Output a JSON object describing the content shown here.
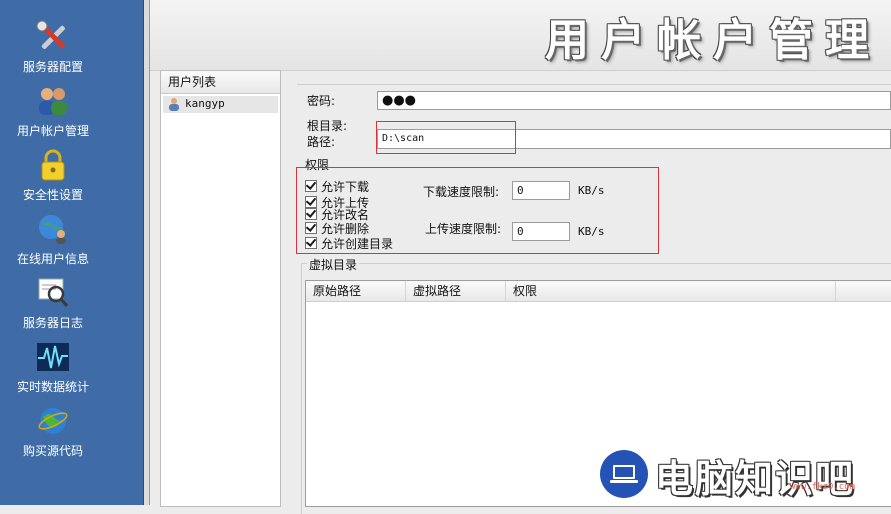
{
  "sidebar": {
    "items": [
      {
        "label": "服务器配置",
        "icon": "tools-icon"
      },
      {
        "label": "用户帐户管理",
        "icon": "users-icon"
      },
      {
        "label": "安全性设置",
        "icon": "lock-icon"
      },
      {
        "label": "在线用户信息",
        "icon": "globe-user-icon"
      },
      {
        "label": "服务器日志",
        "icon": "log-search-icon"
      },
      {
        "label": "实时数据统计",
        "icon": "pulse-icon"
      },
      {
        "label": "购买源代码",
        "icon": "globe-icon"
      }
    ]
  },
  "header": {
    "title": "用户帐户管理"
  },
  "user_list": {
    "header": "用户列表",
    "users": [
      {
        "name": "kangyp",
        "icon": "user-icon"
      }
    ]
  },
  "form": {
    "password_label": "密码:",
    "password_value": "●●●",
    "root_label": "根目录:",
    "path_label": "路径:",
    "path_value": "D:\\scan",
    "permissions_label": "权限",
    "permissions": [
      {
        "label": "允许下载",
        "checked": true
      },
      {
        "label": "允许上传",
        "checked": true
      },
      {
        "label": "允许改名",
        "checked": true
      },
      {
        "label": "允许删除",
        "checked": true
      },
      {
        "label": "允许创建目录",
        "checked": true
      }
    ],
    "download_limit_label": "下载速度限制:",
    "download_limit_value": "0",
    "upload_limit_label": "上传速度限制:",
    "upload_limit_value": "0",
    "unit": "KB/s"
  },
  "virtual_dir": {
    "label": "虚拟目录",
    "columns": [
      "原始路径",
      "虚拟路径",
      "权限"
    ],
    "rows": []
  },
  "watermark": {
    "text": "电脑知识吧",
    "url": "www.fkz0.com"
  },
  "colors": {
    "sidebar_bg": "#3f6ca7",
    "highlight_box": "#d9343c"
  }
}
